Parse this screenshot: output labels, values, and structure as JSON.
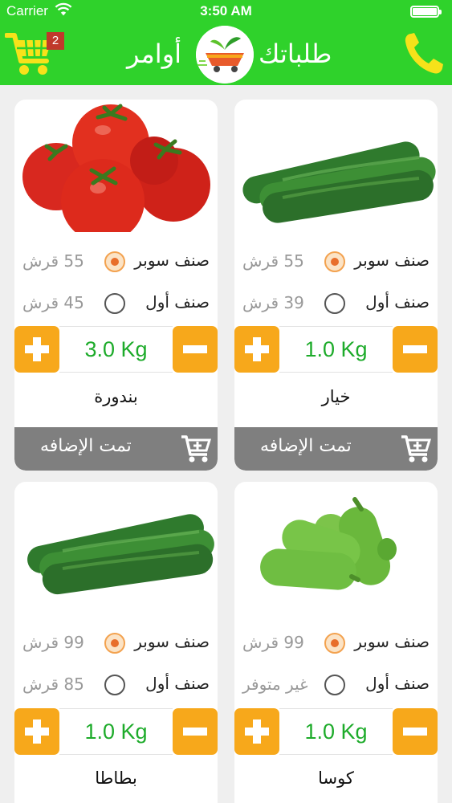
{
  "status_bar": {
    "carrier": "Carrier",
    "time": "3:50 AM"
  },
  "header": {
    "cart_count": "2",
    "orders_label": "أوامر",
    "brand_name": "طلباتك"
  },
  "products": [
    {
      "name": "خيار",
      "image": "cucumber",
      "options": [
        {
          "label": "صنف سوبر",
          "price": "55 قرش",
          "selected": true
        },
        {
          "label": "صنف أول",
          "price": "39 قرش",
          "selected": false
        }
      ],
      "quantity": "1.0 Kg",
      "added_label": "تمت الإضافه"
    },
    {
      "name": "بندورة",
      "image": "tomato",
      "options": [
        {
          "label": "صنف سوبر",
          "price": "55 قرش",
          "selected": true
        },
        {
          "label": "صنف أول",
          "price": "45 قرش",
          "selected": false
        }
      ],
      "quantity": "3.0 Kg",
      "added_label": "تمت الإضافه"
    },
    {
      "name": "كوسا",
      "image": "zucchini",
      "options": [
        {
          "label": "صنف سوبر",
          "price": "99 قرش",
          "selected": true
        },
        {
          "label": "صنف أول",
          "price": "غير متوفر",
          "selected": false
        }
      ],
      "quantity": "1.0 Kg"
    },
    {
      "name": "بطاطا",
      "image": "cucumber",
      "options": [
        {
          "label": "صنف سوبر",
          "price": "99 قرش",
          "selected": true
        },
        {
          "label": "صنف أول",
          "price": "85 قرش",
          "selected": false
        }
      ],
      "quantity": "1.0 Kg"
    }
  ],
  "colors": {
    "header_green": "#2fd22b",
    "accent_orange": "#f7a81b",
    "cart_yellow": "#f6e21a",
    "quantity_green": "#1dab2a",
    "added_gray": "#7f7f7f"
  }
}
